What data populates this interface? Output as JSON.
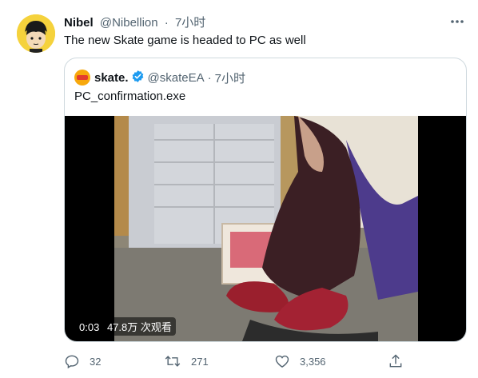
{
  "tweet": {
    "author_name": "Nibel",
    "author_handle": "@Nibellion",
    "separator": "·",
    "time": "7小时",
    "text": "The new Skate game is headed to PC as well",
    "avatar_icon": "cartoon-character-avatar",
    "more_icon": "more-horizontal-icon"
  },
  "quote": {
    "name": "skate.",
    "handle": "@skateEA",
    "separator": "·",
    "time": "7小时",
    "text": "PC_confirmation.exe",
    "verified": true,
    "video": {
      "timestamp": "0:03",
      "views": "47.8万 次观看"
    }
  },
  "actions": {
    "reply": {
      "icon": "reply-icon",
      "count": "32"
    },
    "retweet": {
      "icon": "retweet-icon",
      "count": "271"
    },
    "like": {
      "icon": "heart-icon",
      "count": "3,356"
    },
    "share": {
      "icon": "share-icon"
    }
  },
  "colors": {
    "text_primary": "#0f1419",
    "text_secondary": "#536471",
    "border": "#cfd9de",
    "verified": "#1d9bf0"
  }
}
